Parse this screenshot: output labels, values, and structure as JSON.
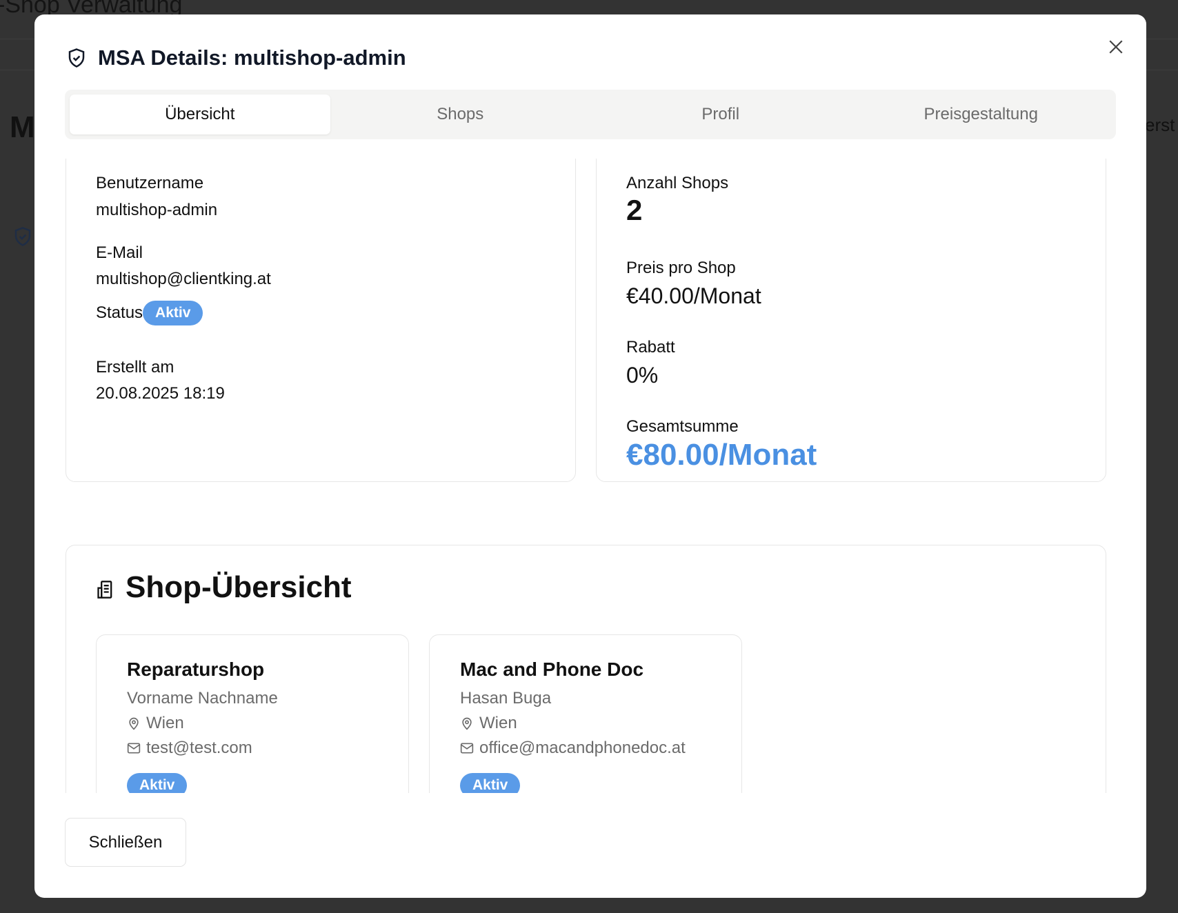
{
  "background": {
    "title": "-Shop Verwaltung",
    "heading_fragment": "M",
    "right_fragment": "erst"
  },
  "modal": {
    "title": "MSA Details: multishop-admin",
    "tabs": [
      {
        "label": "Übersicht",
        "active": true
      },
      {
        "label": "Shops"
      },
      {
        "label": "Profil"
      },
      {
        "label": "Preisgestaltung"
      }
    ],
    "account": {
      "username_label": "Benutzername",
      "username": "multishop-admin",
      "email_label": "E-Mail",
      "email": "multishop@clientking.at",
      "status_label": "Status",
      "status": "Aktiv",
      "created_label": "Erstellt am",
      "created": "20.08.2025 18:19"
    },
    "pricing": {
      "shops_label": "Anzahl Shops",
      "shops": "2",
      "price_label": "Preis pro Shop",
      "price": "€40.00/Monat",
      "discount_label": "Rabatt",
      "discount": "0%",
      "total_label": "Gesamtsumme",
      "total": "€80.00/Monat"
    },
    "shop_overview": {
      "title": "Shop-Übersicht",
      "shops": [
        {
          "name": "Reparaturshop",
          "owner": "Vorname Nachname",
          "city": "Wien",
          "email": "test@test.com",
          "status": "Aktiv"
        },
        {
          "name": "Mac and Phone Doc",
          "owner": "Hasan Buga",
          "city": "Wien",
          "email": "office@macandphonedoc.at",
          "status": "Aktiv"
        }
      ]
    },
    "close_label": "Schließen"
  },
  "colors": {
    "accent": "#4a90e2",
    "badge": "#5a9be8",
    "overlay": "#333333"
  }
}
